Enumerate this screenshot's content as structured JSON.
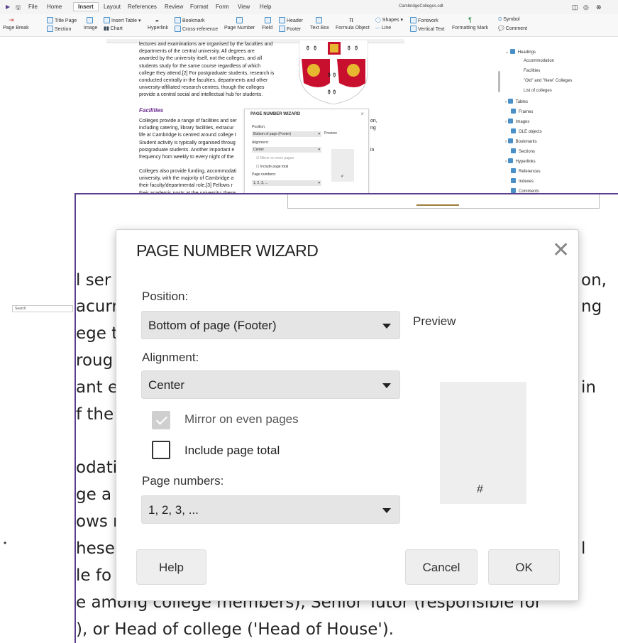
{
  "menubar": {
    "items": [
      "File",
      "Home",
      "Insert",
      "Layout",
      "References",
      "Review",
      "Format",
      "Form",
      "View",
      "Help"
    ],
    "document_title": "CambridgeColleges.odt"
  },
  "ribbon": {
    "page_break": "Page Break",
    "title_page": "Title Page",
    "section": "Section",
    "image": "Image",
    "insert_table": "Insert Table",
    "chart": "Chart",
    "hyperlink": "Hyperlink",
    "bookmark": "Bookmark",
    "cross_reference": "Cross-reference",
    "page_number": "Page Number",
    "field": "Field",
    "header": "Header",
    "footer": "Footer",
    "text_box": "Text Box",
    "formula_object": "Formula Object",
    "shapes": "Shapes",
    "line": "Line",
    "fontwork": "Fontwork",
    "vertical_text": "Vertical Text",
    "formatting_mark": "Formatting Mark",
    "symbol": "Symbol",
    "comment": "Comment"
  },
  "document": {
    "intro_lines": [
      "lectures and examinations are organised by the faculties and",
      "departments of the central university. All degrees are",
      "awarded by the university itself, not the colleges, and all",
      "students study for the same course regardless of which",
      "college they attend.[2] For postgraduate students, research is",
      "conducted centrally in the faculties, departments and other",
      "university-affiliated research centres, though the colleges",
      "provide a central social and intellectual hub for students."
    ],
    "facilities_heading": "Facilities",
    "facilities_lines": [
      "Colleges provide a range of facilities and ser",
      "including catering, library facilities, extracur",
      "life at Cambridge is centred around college t",
      "Student activity is typically organised throug",
      "postgraduate students. Another important e",
      "frequency from weekly to every night of the"
    ],
    "facilities_right": [
      "on,",
      "ng",
      "",
      "",
      "in",
      ""
    ],
    "funding_lines": [
      "Colleges also provide funding, accommodati",
      "university, with the majority of Cambridge a",
      "their faculty/departmental role.[3] Fellows r",
      "their academic posts at the university; these"
    ]
  },
  "mini_wizard": {
    "title": "PAGE NUMBER WIZARD",
    "position_label": "Position:",
    "position_value": "Bottom of page (Footer)",
    "preview_label": "Preview",
    "alignment_label": "Alignment:",
    "alignment_value": "Center",
    "mirror_label": "Mirror on even pages",
    "total_label": "Include page total",
    "page_numbers_label": "Page numbers:",
    "page_numbers_value": "1, 2, 3, ..."
  },
  "navigator": {
    "items": [
      {
        "label": "Headings",
        "indent": 0,
        "expander": "⌄"
      },
      {
        "label": "Accommodation",
        "indent": 2
      },
      {
        "label": "Facilities",
        "indent": 2
      },
      {
        "label": "\"Old\" and \"New\" Colleges",
        "indent": 2
      },
      {
        "label": "List of colleges",
        "indent": 2
      },
      {
        "label": "Tables",
        "indent": 0,
        "expander": "›"
      },
      {
        "label": "Frames",
        "indent": 1
      },
      {
        "label": "Images",
        "indent": 0,
        "expander": "›"
      },
      {
        "label": "OLE objects",
        "indent": 1
      },
      {
        "label": "Bookmarks",
        "indent": 0,
        "expander": "›"
      },
      {
        "label": "Sections",
        "indent": 1
      },
      {
        "label": "Hyperlinks",
        "indent": 0,
        "expander": "›"
      },
      {
        "label": "References",
        "indent": 1
      },
      {
        "label": "Indexes",
        "indent": 1
      },
      {
        "label": "Comments",
        "indent": 1
      }
    ]
  },
  "search": {
    "value": "Search"
  },
  "zoom_text": {
    "left_fragments": [
      "l ser",
      "acurr",
      "ege t",
      "roug",
      "ant e",
      "f the",
      "",
      "odati",
      "ge a",
      "ows r",
      "hese",
      "le fo"
    ],
    "right_fragments": [
      "on,",
      "ng",
      "",
      "",
      "in",
      "",
      "",
      "",
      "",
      "",
      "l",
      ""
    ],
    "bottom_line_1": "e among college members), Senior Tutor (responsible for",
    "bottom_line_2": "), or Head of college ('Head of House')."
  },
  "dialog": {
    "title": "PAGE NUMBER WIZARD",
    "close_glyph": "✕",
    "position_label": "Position:",
    "position_value": "Bottom of page (Footer)",
    "preview_label": "Preview",
    "alignment_label": "Alignment:",
    "alignment_value": "Center",
    "mirror_label": "Mirror on even pages",
    "mirror_checked": true,
    "mirror_enabled": false,
    "total_label": "Include page total",
    "total_checked": false,
    "page_numbers_label": "Page numbers:",
    "page_numbers_value": "1, 2, 3, ...",
    "preview_number": "#",
    "help_label": "Help",
    "cancel_label": "Cancel",
    "ok_label": "OK"
  }
}
